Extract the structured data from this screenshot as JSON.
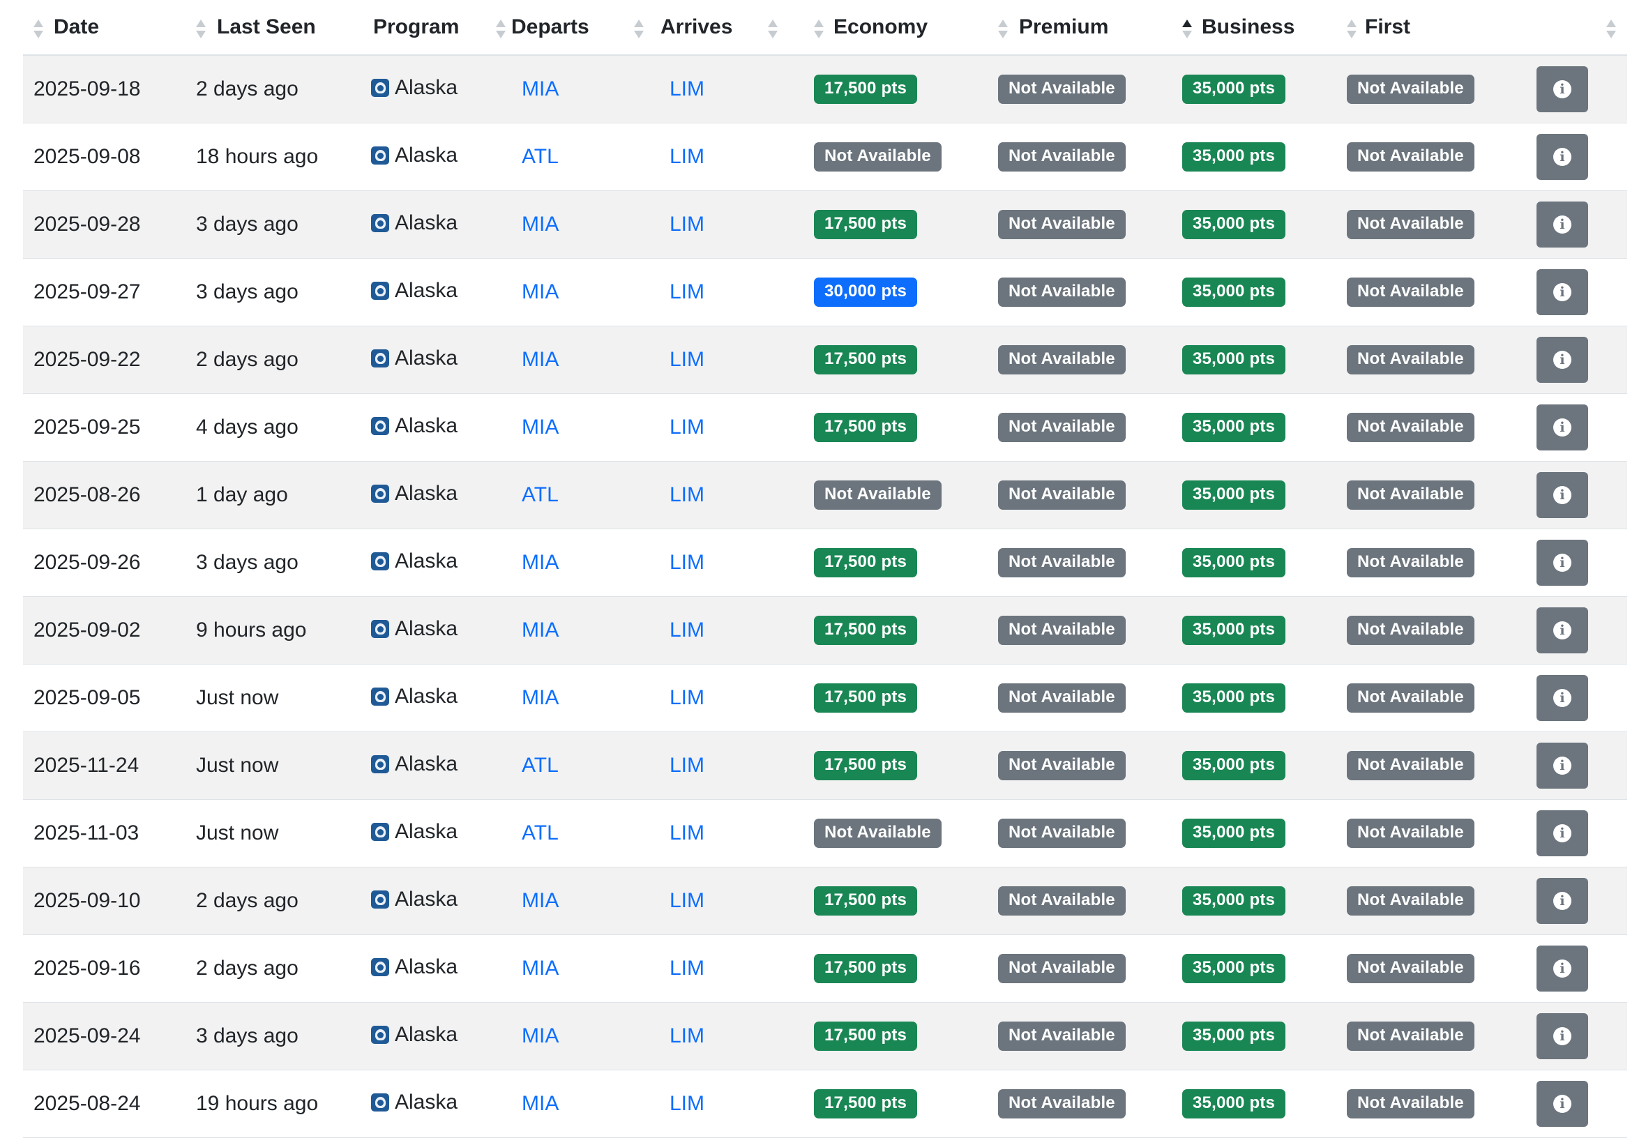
{
  "headers": {
    "date": "Date",
    "last_seen": "Last Seen",
    "program": "Program",
    "departs": "Departs",
    "arrives": "Arrives",
    "economy": "Economy",
    "premium": "Premium",
    "business": "Business",
    "first": "First"
  },
  "sorted_column": "business",
  "icons": {
    "program": "alaska-logo-icon",
    "info": "info-icon"
  },
  "colors": {
    "available": "#198754",
    "unavailable": "#6c757d",
    "highlight": "#0d6efd",
    "link": "#0d6efd"
  },
  "rows": [
    {
      "date": "2025-09-18",
      "last_seen": "2 days ago",
      "program": "Alaska",
      "departs": "MIA",
      "arrives": "LIM",
      "economy": "17,500 pts",
      "economy_status": "green",
      "premium": "Not Available",
      "business": "35,000 pts",
      "first": "Not Available"
    },
    {
      "date": "2025-09-08",
      "last_seen": "18 hours ago",
      "program": "Alaska",
      "departs": "ATL",
      "arrives": "LIM",
      "economy": "Not Available",
      "economy_status": "gray",
      "premium": "Not Available",
      "business": "35,000 pts",
      "first": "Not Available"
    },
    {
      "date": "2025-09-28",
      "last_seen": "3 days ago",
      "program": "Alaska",
      "departs": "MIA",
      "arrives": "LIM",
      "economy": "17,500 pts",
      "economy_status": "green",
      "premium": "Not Available",
      "business": "35,000 pts",
      "first": "Not Available"
    },
    {
      "date": "2025-09-27",
      "last_seen": "3 days ago",
      "program": "Alaska",
      "departs": "MIA",
      "arrives": "LIM",
      "economy": "30,000 pts",
      "economy_status": "blue",
      "premium": "Not Available",
      "business": "35,000 pts",
      "first": "Not Available"
    },
    {
      "date": "2025-09-22",
      "last_seen": "2 days ago",
      "program": "Alaska",
      "departs": "MIA",
      "arrives": "LIM",
      "economy": "17,500 pts",
      "economy_status": "green",
      "premium": "Not Available",
      "business": "35,000 pts",
      "first": "Not Available"
    },
    {
      "date": "2025-09-25",
      "last_seen": "4 days ago",
      "program": "Alaska",
      "departs": "MIA",
      "arrives": "LIM",
      "economy": "17,500 pts",
      "economy_status": "green",
      "premium": "Not Available",
      "business": "35,000 pts",
      "first": "Not Available"
    },
    {
      "date": "2025-08-26",
      "last_seen": "1 day ago",
      "program": "Alaska",
      "departs": "ATL",
      "arrives": "LIM",
      "economy": "Not Available",
      "economy_status": "gray",
      "premium": "Not Available",
      "business": "35,000 pts",
      "first": "Not Available"
    },
    {
      "date": "2025-09-26",
      "last_seen": "3 days ago",
      "program": "Alaska",
      "departs": "MIA",
      "arrives": "LIM",
      "economy": "17,500 pts",
      "economy_status": "green",
      "premium": "Not Available",
      "business": "35,000 pts",
      "first": "Not Available"
    },
    {
      "date": "2025-09-02",
      "last_seen": "9 hours ago",
      "program": "Alaska",
      "departs": "MIA",
      "arrives": "LIM",
      "economy": "17,500 pts",
      "economy_status": "green",
      "premium": "Not Available",
      "business": "35,000 pts",
      "first": "Not Available"
    },
    {
      "date": "2025-09-05",
      "last_seen": "Just now",
      "program": "Alaska",
      "departs": "MIA",
      "arrives": "LIM",
      "economy": "17,500 pts",
      "economy_status": "green",
      "premium": "Not Available",
      "business": "35,000 pts",
      "first": "Not Available"
    },
    {
      "date": "2025-11-24",
      "last_seen": "Just now",
      "program": "Alaska",
      "departs": "ATL",
      "arrives": "LIM",
      "economy": "17,500 pts",
      "economy_status": "green",
      "premium": "Not Available",
      "business": "35,000 pts",
      "first": "Not Available"
    },
    {
      "date": "2025-11-03",
      "last_seen": "Just now",
      "program": "Alaska",
      "departs": "ATL",
      "arrives": "LIM",
      "economy": "Not Available",
      "economy_status": "gray",
      "premium": "Not Available",
      "business": "35,000 pts",
      "first": "Not Available"
    },
    {
      "date": "2025-09-10",
      "last_seen": "2 days ago",
      "program": "Alaska",
      "departs": "MIA",
      "arrives": "LIM",
      "economy": "17,500 pts",
      "economy_status": "green",
      "premium": "Not Available",
      "business": "35,000 pts",
      "first": "Not Available"
    },
    {
      "date": "2025-09-16",
      "last_seen": "2 days ago",
      "program": "Alaska",
      "departs": "MIA",
      "arrives": "LIM",
      "economy": "17,500 pts",
      "economy_status": "green",
      "premium": "Not Available",
      "business": "35,000 pts",
      "first": "Not Available"
    },
    {
      "date": "2025-09-24",
      "last_seen": "3 days ago",
      "program": "Alaska",
      "departs": "MIA",
      "arrives": "LIM",
      "economy": "17,500 pts",
      "economy_status": "green",
      "premium": "Not Available",
      "business": "35,000 pts",
      "first": "Not Available"
    },
    {
      "date": "2025-08-24",
      "last_seen": "19 hours ago",
      "program": "Alaska",
      "departs": "MIA",
      "arrives": "LIM",
      "economy": "17,500 pts",
      "economy_status": "green",
      "premium": "Not Available",
      "business": "35,000 pts",
      "first": "Not Available"
    }
  ]
}
